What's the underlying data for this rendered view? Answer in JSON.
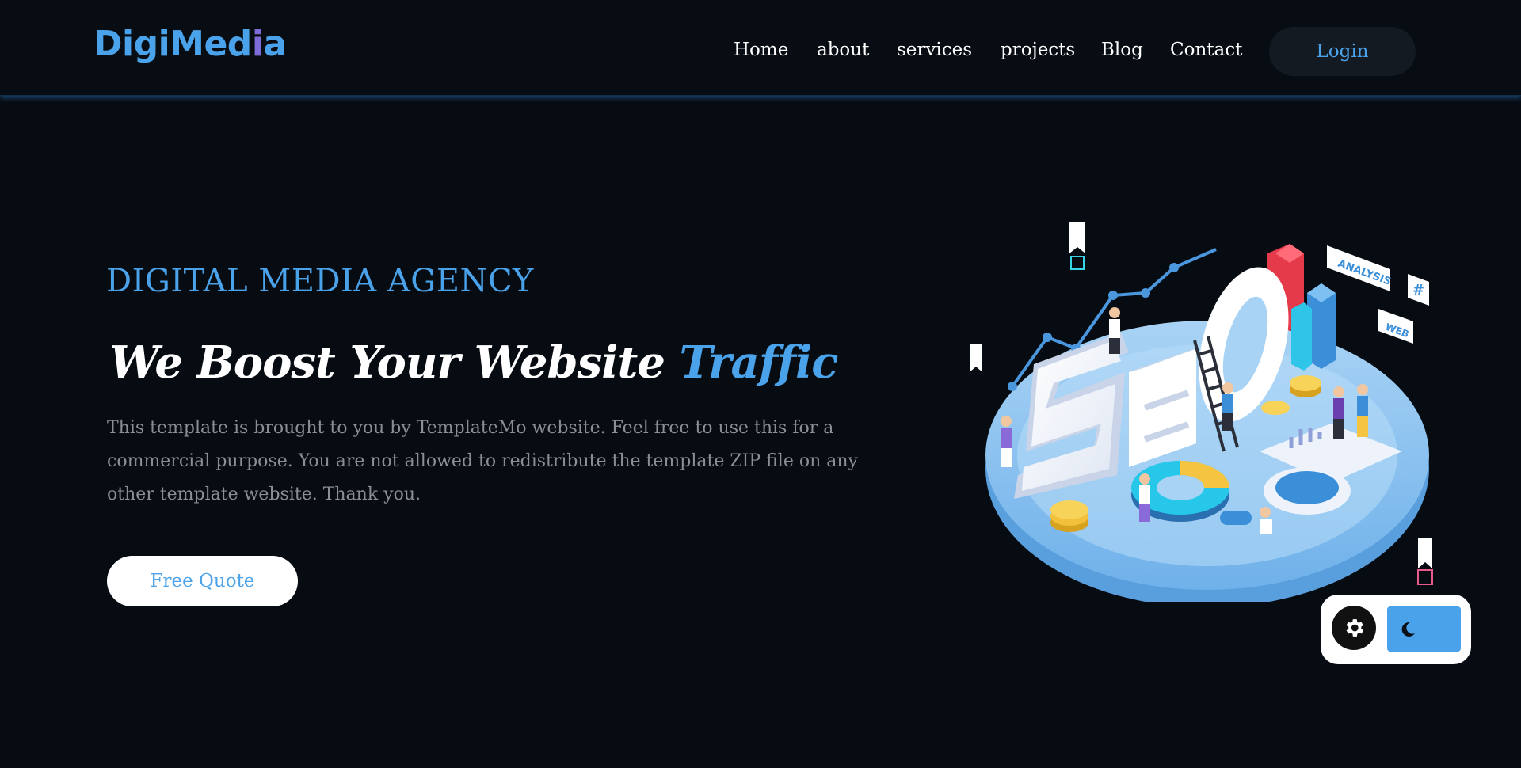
{
  "brand": {
    "logo_main": "DigiMed",
    "logo_accent": "i",
    "logo_tail": "a"
  },
  "nav": {
    "items": [
      {
        "label": "Home"
      },
      {
        "label": "about"
      },
      {
        "label": "services"
      },
      {
        "label": "projects"
      },
      {
        "label": "Blog"
      },
      {
        "label": "Contact"
      }
    ],
    "login_label": "Login"
  },
  "hero": {
    "eyebrow": "DIGITAL MEDIA AGENCY",
    "headline_main": "We Boost Your Website ",
    "headline_highlight": "Traffic",
    "description": "This template is brought to you by TemplateMo website. Feel free to use this for a commercial purpose. You are not allowed to redistribute the template ZIP file on any other template website. Thank you.",
    "cta_label": "Free Quote",
    "illustration": {
      "big_text": "SEO",
      "tags": [
        "ANALYSIS",
        "#",
        "WEB"
      ]
    }
  },
  "theme_switcher": {
    "gear_icon": "gear-icon",
    "moon_icon": "moon-icon",
    "mode": "dark"
  },
  "colors": {
    "accent": "#4aa3ea",
    "logo_accent": "#7d6cd8",
    "background": "#070c12",
    "body_text": "#8a8f96"
  }
}
